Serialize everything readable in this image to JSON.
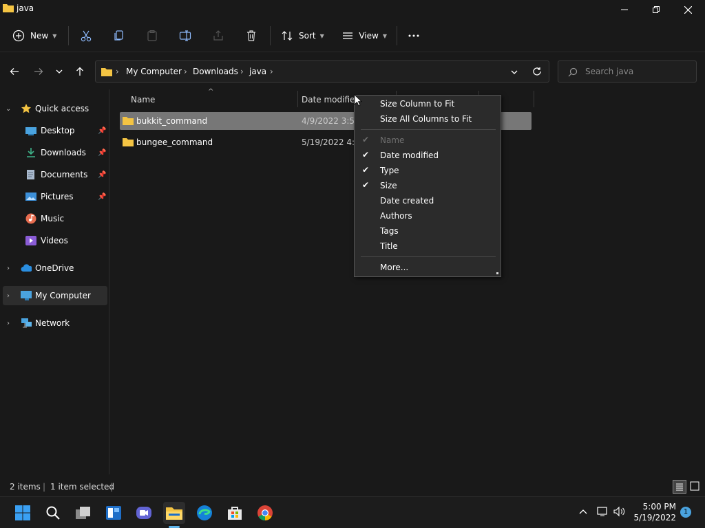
{
  "window": {
    "title": "java"
  },
  "toolbar": {
    "new_label": "New",
    "sort_label": "Sort",
    "view_label": "View"
  },
  "address": {
    "crumbs": [
      "My Computer",
      "Downloads",
      "java"
    ],
    "search_placeholder": "Search java"
  },
  "nav": {
    "quick_access": "Quick access",
    "items": [
      "Desktop",
      "Downloads",
      "Documents",
      "Pictures",
      "Music",
      "Videos"
    ],
    "onedrive": "OneDrive",
    "my_computer": "My Computer",
    "network": "Network"
  },
  "columns": {
    "name": "Name",
    "date_modified": "Date modified"
  },
  "files": [
    {
      "name": "bukkit_command",
      "date": "4/9/2022 3:57 PM"
    },
    {
      "name": "bungee_command",
      "date": "5/19/2022 4:56 PM"
    }
  ],
  "status": {
    "count": "2 items",
    "selected": "1 item selected"
  },
  "menu": {
    "size_column": "Size Column to Fit",
    "size_all": "Size All Columns to Fit",
    "cols": [
      {
        "label": "Name",
        "checked": true,
        "disabled": true
      },
      {
        "label": "Date modified",
        "checked": true,
        "disabled": false
      },
      {
        "label": "Type",
        "checked": true,
        "disabled": false
      },
      {
        "label": "Size",
        "checked": true,
        "disabled": false
      },
      {
        "label": "Date created",
        "checked": false,
        "disabled": false
      },
      {
        "label": "Authors",
        "checked": false,
        "disabled": false
      },
      {
        "label": "Tags",
        "checked": false,
        "disabled": false
      },
      {
        "label": "Title",
        "checked": false,
        "disabled": false
      }
    ],
    "more": "More..."
  },
  "taskbar": {
    "time": "5:00 PM",
    "date": "5/19/2022",
    "notifications": "1"
  },
  "colors": {
    "folder": "#f4c443",
    "accent": "#0078d4",
    "selected_row": "#777777"
  }
}
